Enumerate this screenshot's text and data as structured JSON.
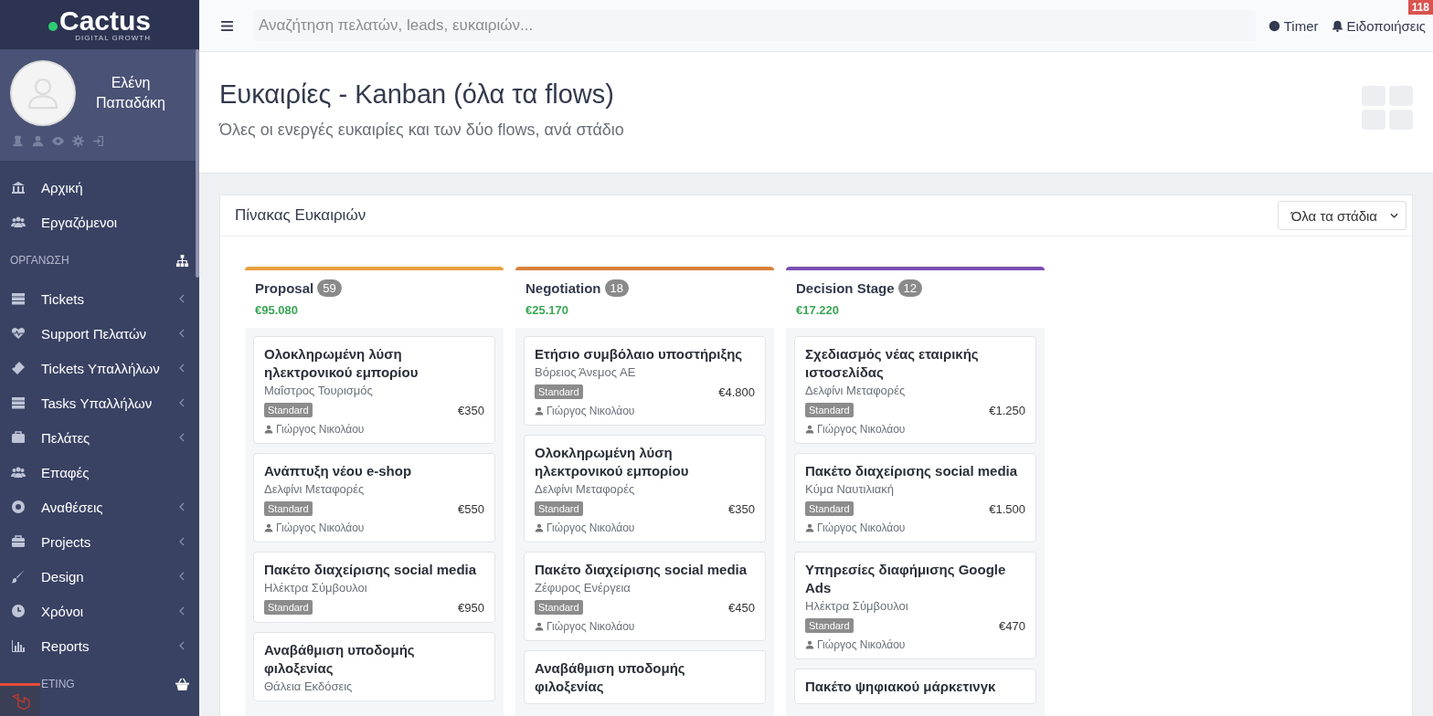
{
  "sidebar": {
    "logo": {
      "text": "Cactus",
      "tagline": "DIGITAL GROWTH"
    },
    "user": {
      "name": "Ελένη Παπαδάκη"
    },
    "items": [
      {
        "kind": "link",
        "label": "Αρχική",
        "expandable": false
      },
      {
        "kind": "link",
        "label": "Εργαζόμενοι",
        "expandable": false
      },
      {
        "kind": "section",
        "label": "ΟΡΓΑΝΩΣΗ"
      },
      {
        "kind": "link",
        "label": "Tickets",
        "expandable": true
      },
      {
        "kind": "link",
        "label": "Support Πελατών",
        "expandable": true
      },
      {
        "kind": "link",
        "label": "Tickets Υπαλλήλων",
        "expandable": true
      },
      {
        "kind": "link",
        "label": "Tasks Υπαλλήλων",
        "expandable": true
      },
      {
        "kind": "link",
        "label": "Πελάτες",
        "expandable": true
      },
      {
        "kind": "link",
        "label": "Επαφές",
        "expandable": false
      },
      {
        "kind": "link",
        "label": "Αναθέσεις",
        "expandable": true
      },
      {
        "kind": "link",
        "label": "Projects",
        "expandable": true
      },
      {
        "kind": "link",
        "label": "Design",
        "expandable": true
      },
      {
        "kind": "link",
        "label": "Χρόνοι",
        "expandable": true
      },
      {
        "kind": "link",
        "label": "Reports",
        "expandable": true
      },
      {
        "kind": "section",
        "label": "ETING"
      }
    ]
  },
  "topbar": {
    "search": {
      "placeholder": "Αναζήτηση πελατών, leads, ευκαιριών..."
    },
    "timer": "Timer",
    "notifications": "Ειδοποιήσεις",
    "notification_count": "118"
  },
  "page": {
    "title": "Ευκαιρίες - Kanban (όλα τα flows)",
    "subtitle": "Όλες οι ενεργές ευκαιρίες και των δύο flows, ανά στάδιο"
  },
  "board": {
    "title": "Πίνακας Ευκαιριών",
    "filter": "Όλα τα στάδια",
    "columns": [
      {
        "name": "Proposal",
        "count": "59",
        "total": "€95.080",
        "color": "#e8a03c",
        "cards": [
          {
            "title": "Ολοκληρωμένη λύση ηλεκτρονικού εμπορίου",
            "company": "Μαΐστρος Τουρισμός",
            "tag": "Standard",
            "amount": "€350",
            "owner": "Γιώργος Νικολάου"
          },
          {
            "title": "Ανάπτυξη νέου e-shop",
            "company": "Δελφίνι Μεταφορές",
            "tag": "Standard",
            "amount": "€550",
            "owner": "Γιώργος Νικολάου"
          },
          {
            "title": "Πακέτο διαχείρισης social media",
            "company": "Ηλέκτρα Σύμβουλοι",
            "tag": "Standard",
            "amount": "€950"
          },
          {
            "title": "Αναβάθμιση υποδομής φιλοξενίας",
            "company": "Θάλεια Εκδόσεις"
          }
        ]
      },
      {
        "name": "Negotiation",
        "count": "18",
        "total": "€25.170",
        "color": "#d9803a",
        "cards": [
          {
            "title": "Ετήσιο συμβόλαιο υποστήριξης",
            "company": "Βόρειος Άνεμος ΑΕ",
            "tag": "Standard",
            "amount": "€4.800",
            "owner": "Γιώργος Νικολάου"
          },
          {
            "title": "Ολοκληρωμένη λύση ηλεκτρονικού εμπορίου",
            "company": "Δελφίνι Μεταφορές",
            "tag": "Standard",
            "amount": "€350",
            "owner": "Γιώργος Νικολάου"
          },
          {
            "title": "Πακέτο διαχείρισης social media",
            "company": "Ζέφυρος Ενέργεια",
            "tag": "Standard",
            "amount": "€450",
            "owner": "Γιώργος Νικολάου"
          },
          {
            "title": "Αναβάθμιση υποδομής φιλοξενίας"
          }
        ]
      },
      {
        "name": "Decision Stage",
        "count": "12",
        "total": "€17.220",
        "color": "#7b4fb3",
        "cards": [
          {
            "title": "Σχεδιασμός νέας εταιρικής ιστοσελίδας",
            "company": "Δελφίνι Μεταφορές",
            "tag": "Standard",
            "amount": "€1.250",
            "owner": "Γιώργος Νικολάου"
          },
          {
            "title": "Πακέτο διαχείρισης social media",
            "company": "Κύμα Ναυτιλιακή",
            "tag": "Standard",
            "amount": "€1.500",
            "owner": "Γιώργος Νικολάου"
          },
          {
            "title": "Υπηρεσίες διαφήμισης Google Ads",
            "company": "Ηλέκτρα Σύμβουλοι",
            "tag": "Standard",
            "amount": "€470",
            "owner": "Γιώργος Νικολάου"
          },
          {
            "title": "Πακέτο ψηφιακού μάρκετινγκ"
          }
        ]
      }
    ]
  }
}
